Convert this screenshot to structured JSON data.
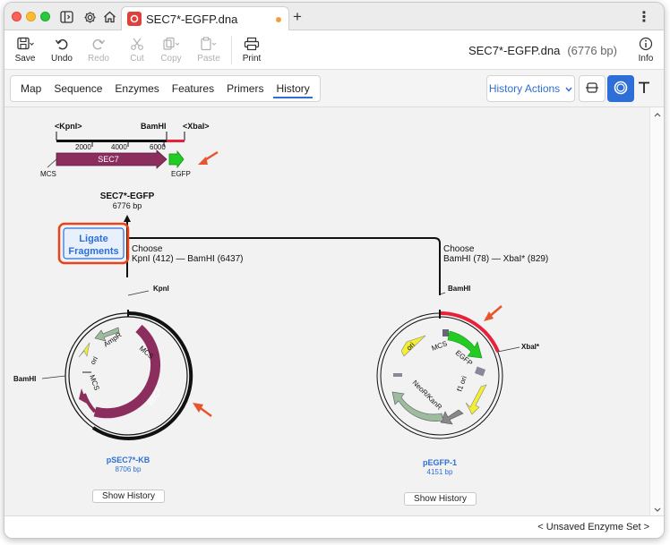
{
  "titlebar": {
    "doc_title": "SEC7*-EGFP.dna",
    "new_tab": "+",
    "more": "⋮"
  },
  "toolbar": {
    "save": "Save",
    "undo": "Undo",
    "redo": "Redo",
    "cut": "Cut",
    "copy": "Copy",
    "paste": "Paste",
    "print": "Print",
    "info": "Info",
    "filename": "SEC7*-EGFP.dna",
    "length": "(6776 bp)"
  },
  "tabs": [
    "Map",
    "Sequence",
    "Enzymes",
    "Features",
    "Primers",
    "History"
  ],
  "active_tab": "History",
  "history_actions": "History Actions",
  "product": {
    "name": "SEC7*-EGFP",
    "length": "6776 bp",
    "sites": [
      "<KpnI>",
      "BamHI",
      "<XbaI>"
    ],
    "ticks": [
      "2000",
      "4000",
      "6000"
    ],
    "features": [
      "SEC7",
      "MCS",
      "EGFP"
    ]
  },
  "operation": {
    "line1": "Ligate",
    "line2": "Fragments"
  },
  "left_choice": {
    "choose": "Choose",
    "detail": "KpnI (412)  —  BamHI (6437)"
  },
  "right_choice": {
    "choose": "Choose",
    "detail": "BamHI (78)  —  XbaI* (829)"
  },
  "left_plasmid": {
    "name": "pSEC7*-KB",
    "length": "8706 bp",
    "sites": [
      "KpnI",
      "BamHI"
    ],
    "features": [
      "MCS",
      "AmpR",
      "ori",
      "MCS",
      "SEC7"
    ],
    "show_history": "Show History"
  },
  "right_plasmid": {
    "name": "pEGFP-1",
    "length": "4151 bp",
    "sites": [
      "BamHI",
      "XbaI*"
    ],
    "features": [
      "ori",
      "MCS",
      "EGFP",
      "f1 ori",
      "NeoR/KanR"
    ],
    "show_history": "Show History"
  },
  "status": {
    "enzyme_set": "< Unsaved Enzyme Set >"
  },
  "colors": {
    "accent": "#2d6fd6",
    "sec7": "#8b2e5e",
    "egfp": "#22cc22",
    "highlight": "#e8203a",
    "arrow": "#e8552a"
  }
}
